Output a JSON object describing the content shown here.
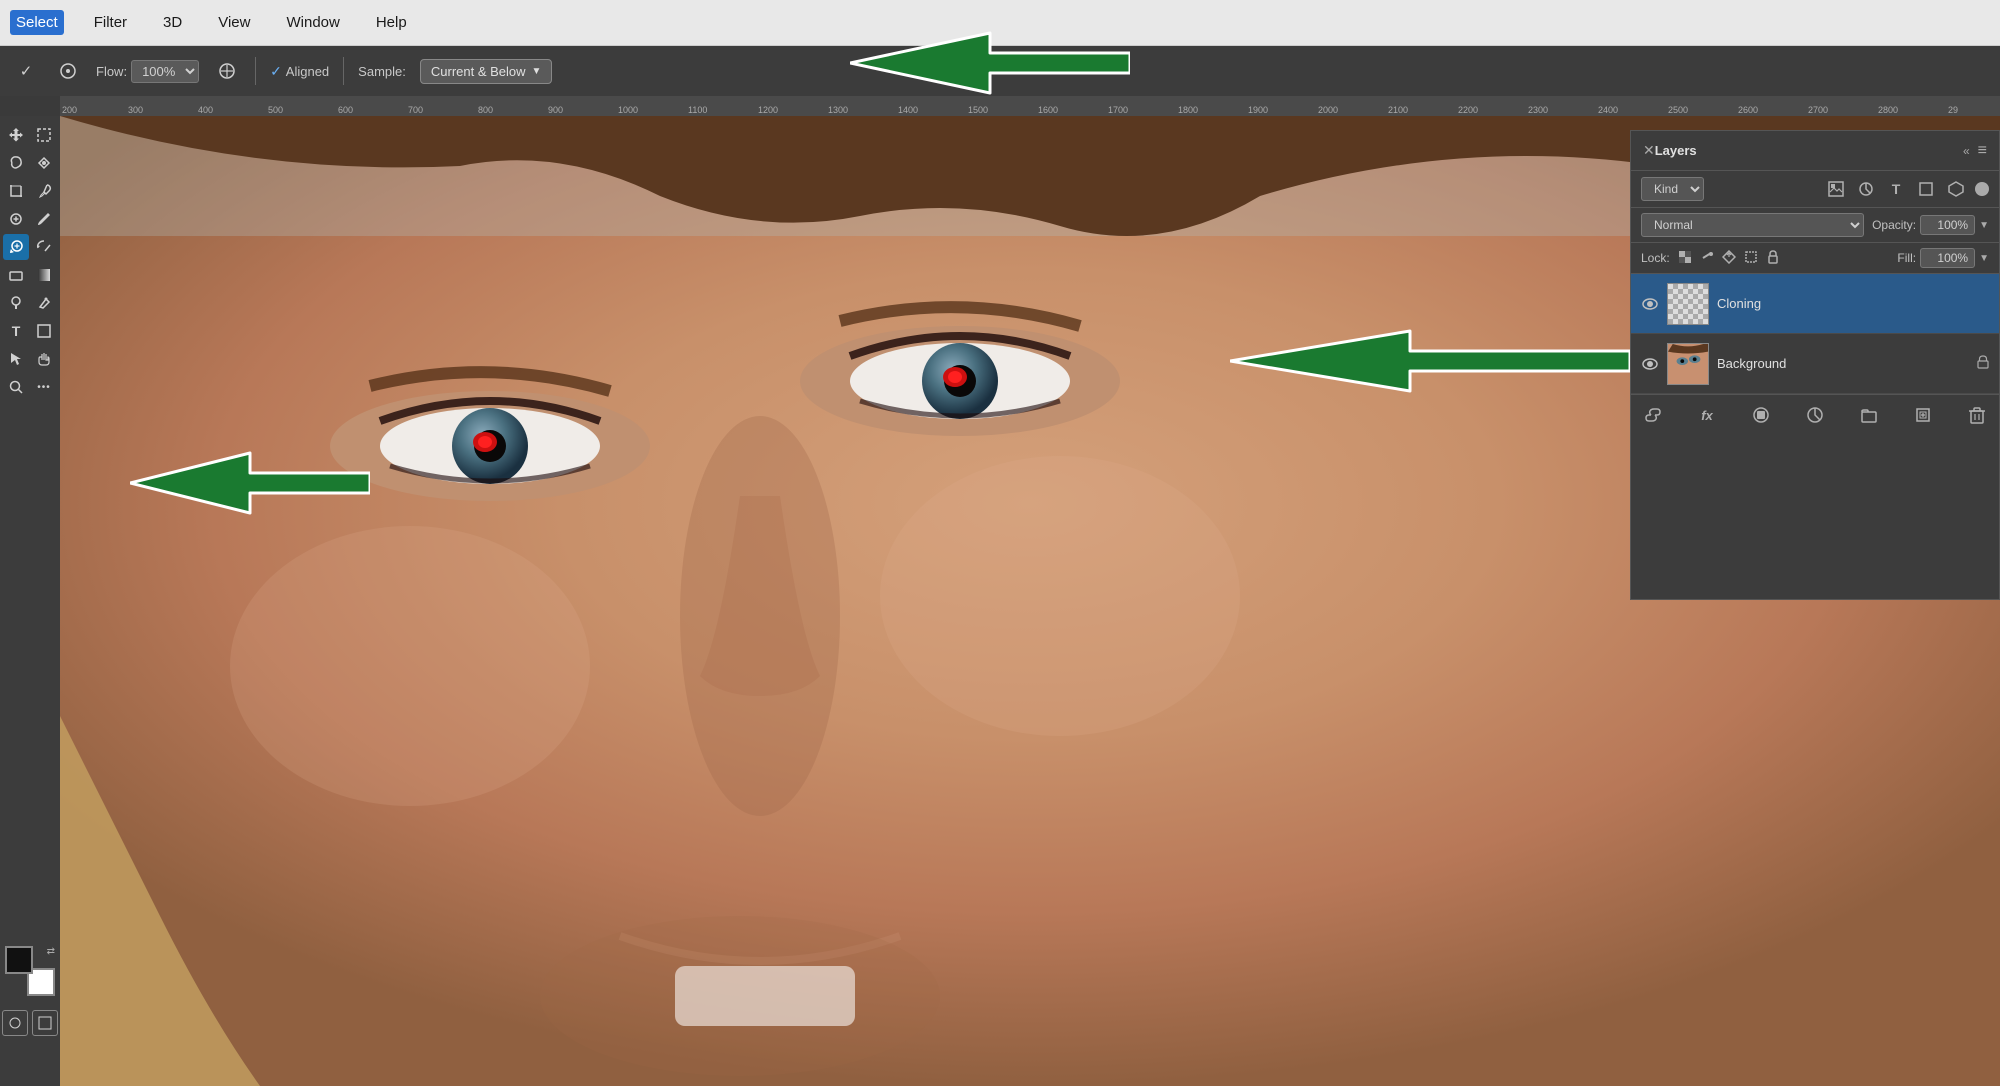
{
  "menu": {
    "items": [
      "Select",
      "Filter",
      "3D",
      "View",
      "Window",
      "Help"
    ],
    "active": "Select"
  },
  "toolbar": {
    "flow_label": "Flow:",
    "flow_value": "100%",
    "aligned_label": "Aligned",
    "sample_label": "Sample:",
    "sample_value": "Current & Below",
    "brush_icon": "⊙",
    "clone_stamp_icon": "⌖",
    "aligned_check": "✓"
  },
  "ruler": {
    "marks": [
      "200",
      "300",
      "400",
      "500",
      "600",
      "700",
      "800",
      "900",
      "1000",
      "1100",
      "1200",
      "1300",
      "1400",
      "1500",
      "1600",
      "1700",
      "1800",
      "1900",
      "2000",
      "2100",
      "2200",
      "2300",
      "2400",
      "2500",
      "2600",
      "2700",
      "2800",
      "29"
    ]
  },
  "tools": {
    "groups": [
      [
        "move",
        "marquee"
      ],
      [
        "lasso",
        "magic-wand"
      ],
      [
        "crop",
        "eyedropper"
      ],
      [
        "spot-heal",
        "brush"
      ],
      [
        "clone-stamp",
        "history-brush"
      ],
      [
        "eraser",
        "gradient"
      ],
      [
        "dodge",
        "pen"
      ],
      [
        "type",
        "path-select"
      ],
      [
        "direct-select",
        "hand"
      ],
      [
        "zoom",
        "more"
      ]
    ]
  },
  "layers_panel": {
    "title": "Layers",
    "close_btn": "✕",
    "menu_icon": "≡",
    "kind_label": "Kind",
    "kind_icons": [
      "🖼",
      "⊘",
      "T",
      "▣",
      "🔗",
      "⊕"
    ],
    "normal_label": "Normal",
    "opacity_label": "Opacity:",
    "opacity_value": "100%",
    "lock_label": "Lock:",
    "lock_icons": [
      "▦",
      "✏",
      "✛",
      "▣",
      "🔒"
    ],
    "fill_label": "Fill:",
    "fill_value": "100%",
    "layers": [
      {
        "name": "Cloning",
        "visible": true,
        "selected": true,
        "type": "empty",
        "locked": false
      },
      {
        "name": "Background",
        "visible": true,
        "selected": false,
        "type": "face",
        "locked": true
      }
    ],
    "footer_icons": [
      "link",
      "fx",
      "mask",
      "circle",
      "folder",
      "crop",
      "trash"
    ]
  },
  "arrows": {
    "top_arrow_label": "Sample dropdown arrow",
    "tool_arrow_label": "Clone stamp tool arrow",
    "layer_arrow_label": "Cloning layer arrow"
  }
}
